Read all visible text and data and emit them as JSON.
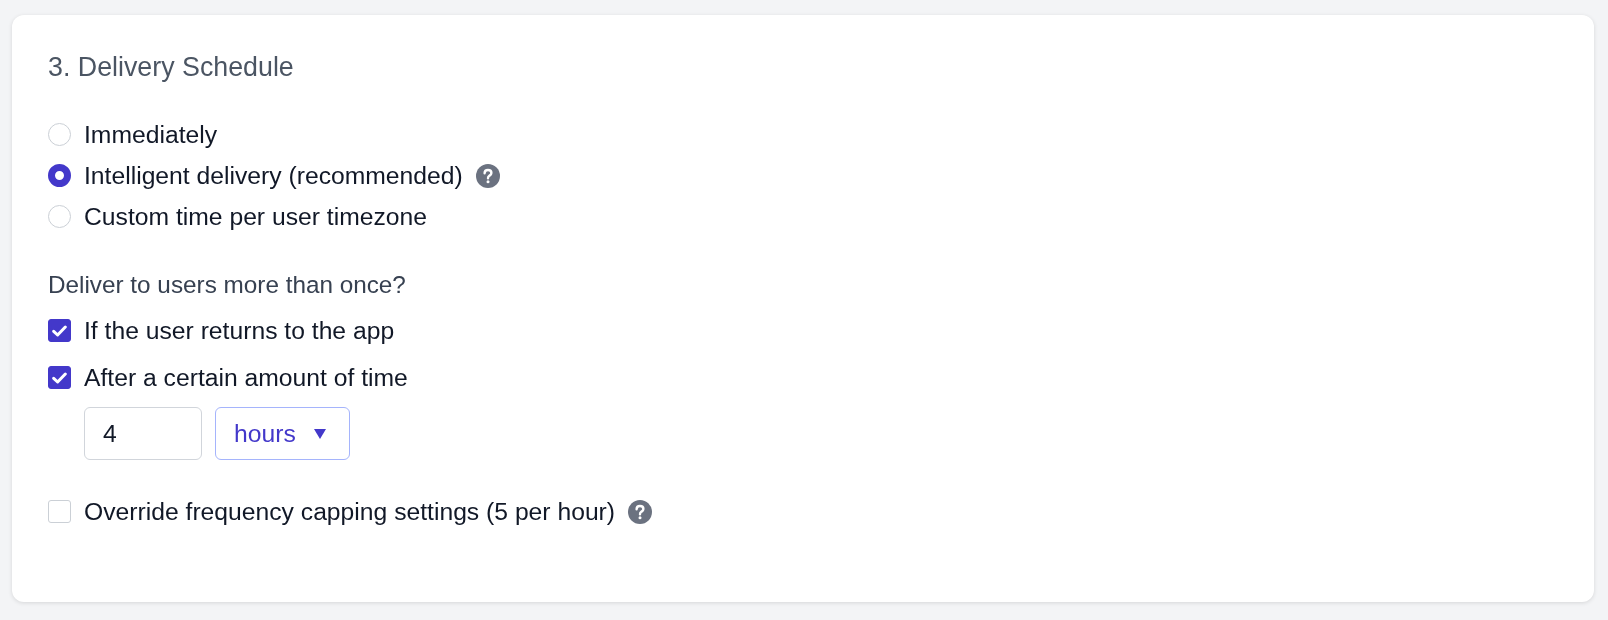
{
  "section": {
    "title": "3. Delivery Schedule"
  },
  "schedule_options": [
    {
      "label": "Immediately",
      "selected": false,
      "help": false
    },
    {
      "label": "Intelligent delivery (recommended)",
      "selected": true,
      "help": true
    },
    {
      "label": "Custom time per user timezone",
      "selected": false,
      "help": false
    }
  ],
  "repeat": {
    "question": "Deliver to users more than once?",
    "options": [
      {
        "label": "If the user returns to the app",
        "checked": true
      },
      {
        "label": "After a certain amount of time",
        "checked": true,
        "interval": {
          "value": "4",
          "unit": "hours"
        }
      }
    ]
  },
  "frequency_override": {
    "label": "Override frequency capping settings (5 per hour)",
    "checked": false,
    "help": true
  }
}
